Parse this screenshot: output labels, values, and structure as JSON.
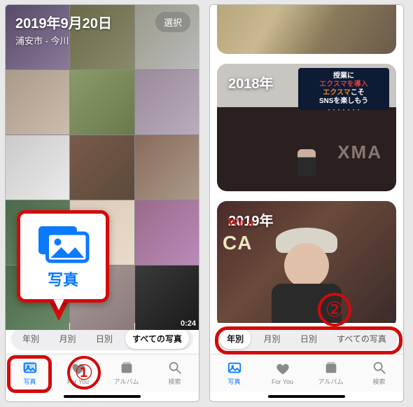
{
  "left": {
    "header_date": "2019年9月20日",
    "header_location": "浦安市 - 今川",
    "select_label": "選択",
    "video_duration": "0:24",
    "segments": {
      "s0": "年別",
      "s1": "月別",
      "s2": "日別",
      "s3": "すべての写真",
      "active_index": 3
    },
    "tabs": {
      "t0": "写真",
      "t1": "For You",
      "t2": "アルバム",
      "t3": "検索",
      "active_index": 0
    },
    "callout_label": "写真"
  },
  "right": {
    "years": {
      "y2018": "2018年",
      "y2019": "2019年"
    },
    "banner2018": {
      "l1": "授業に",
      "l2": "エクスマを導入",
      "l3a": "エクスマ",
      "l3b": "こそ",
      "l4": "SNSを楽しもう"
    },
    "stage_text": "XMA",
    "sign_we": "We a",
    "sign_ca": "CA",
    "segments": {
      "s0": "年別",
      "s1": "月別",
      "s2": "日別",
      "s3": "すべての写真",
      "active_index": 0
    },
    "tabs": {
      "t0": "写真",
      "t1": "For You",
      "t2": "アルバム",
      "t3": "検索",
      "active_index": 0
    }
  },
  "annotations": {
    "num1": "①",
    "num2": "②"
  }
}
